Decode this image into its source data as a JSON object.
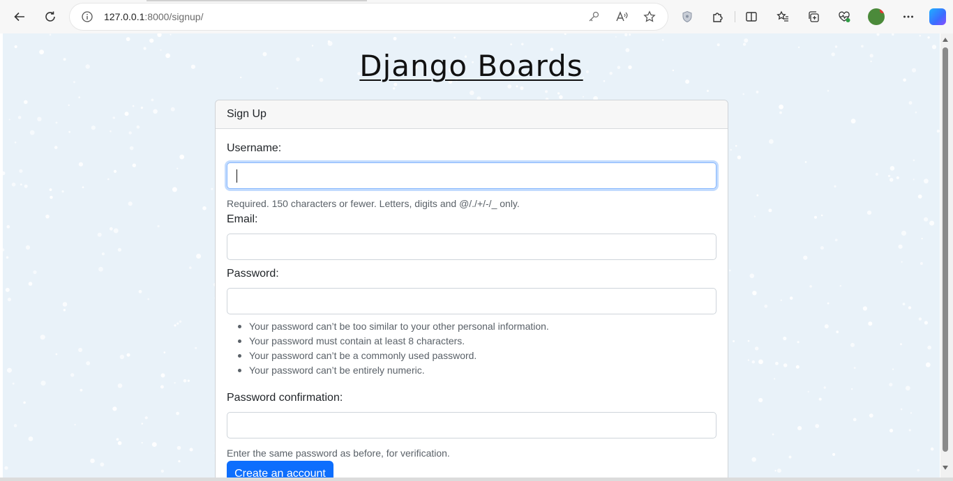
{
  "browser": {
    "url_host": "127.0.0.1",
    "url_path": ":8000/signup/",
    "icons": [
      "back-icon",
      "refresh-icon",
      "info-icon",
      "key-icon",
      "read-aloud-icon",
      "favorite-star-icon",
      "shield-icon",
      "extensions-icon",
      "split-screen-icon",
      "favorites-icon",
      "collections-icon",
      "heart-pulse-icon",
      "profile-avatar",
      "more-icon",
      "copilot-icon"
    ]
  },
  "page": {
    "brand": "Django Boards",
    "card_title": "Sign Up",
    "username_label": "Username:",
    "username_help": "Required. 150 characters or fewer. Letters, digits and @/./+/-/_ only.",
    "email_label": "Email:",
    "password_label": "Password:",
    "password_rules": [
      "Your password can’t be too similar to your other personal information.",
      "Your password must contain at least 8 characters.",
      "Your password can’t be a commonly used password.",
      "Your password can’t be entirely numeric."
    ],
    "confirm_label": "Password confirmation:",
    "confirm_help": "Enter the same password as before, for verification.",
    "submit_label": "Create an account"
  },
  "colors": {
    "primary": "#0d6efd",
    "background": "#e9f2f9",
    "focus_ring": "#86b7fe"
  }
}
